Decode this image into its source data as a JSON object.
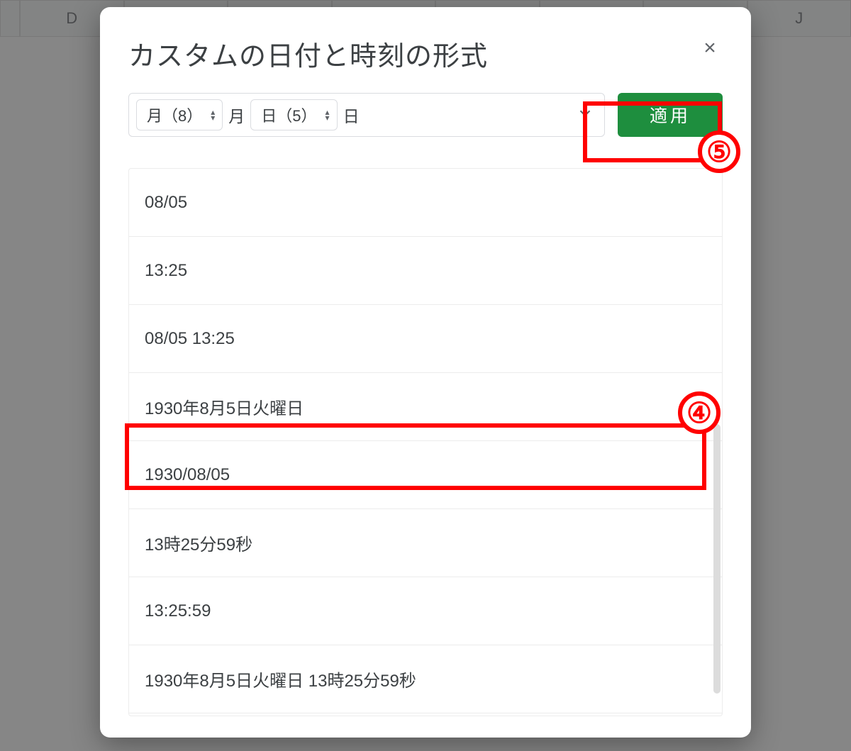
{
  "sheet": {
    "visible_columns": [
      "D",
      "",
      "",
      "",
      "",
      "",
      "",
      "J"
    ]
  },
  "dialog": {
    "title": "カスタムの日付と時刻の形式",
    "apply_label": "適用",
    "format_input": {
      "chips": [
        {
          "label": "月（8）",
          "suffix": "月"
        },
        {
          "label": "日（5）",
          "suffix": "日"
        }
      ]
    },
    "presets": [
      "08/05",
      "13:25",
      "08/05 13:25",
      "1930年8月5日火曜日",
      "1930/08/05",
      "13時25分59秒",
      "13:25:59",
      "1930年8月5日火曜日 13時25分59秒"
    ]
  },
  "annotations": {
    "callout4": "④",
    "callout5": "⑤"
  }
}
